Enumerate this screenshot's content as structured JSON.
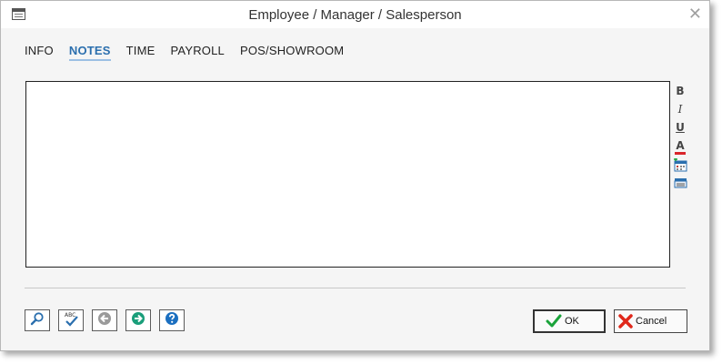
{
  "window": {
    "title": "Employee / Manager / Salesperson"
  },
  "tabs": [
    {
      "label": "INFO",
      "active": false
    },
    {
      "label": "NOTES",
      "active": true
    },
    {
      "label": "TIME",
      "active": false
    },
    {
      "label": "PAYROLL",
      "active": false
    },
    {
      "label": "POS/SHOWROOM",
      "active": false
    }
  ],
  "notes": {
    "value": ""
  },
  "format_toolbar": {
    "bold": "B",
    "italic": "I",
    "underline": "U",
    "font_color": "A",
    "icons": [
      "bold-icon",
      "italic-icon",
      "underline-icon",
      "font-color-icon",
      "insert-date-icon",
      "print-icon"
    ]
  },
  "bottom_toolbar": {
    "icons": [
      "search-icon",
      "spell-check-icon",
      "back-icon",
      "forward-icon",
      "help-icon"
    ],
    "spell_check_text": "ABC"
  },
  "buttons": {
    "ok": "OK",
    "cancel": "Cancel"
  },
  "colors": {
    "active_tab": "#2b6fae",
    "back": "#9a9a9a",
    "forward": "#1a9e7a",
    "help": "#1b6fc0",
    "ok_check": "#1aa33a",
    "cancel_x": "#e0281b"
  }
}
